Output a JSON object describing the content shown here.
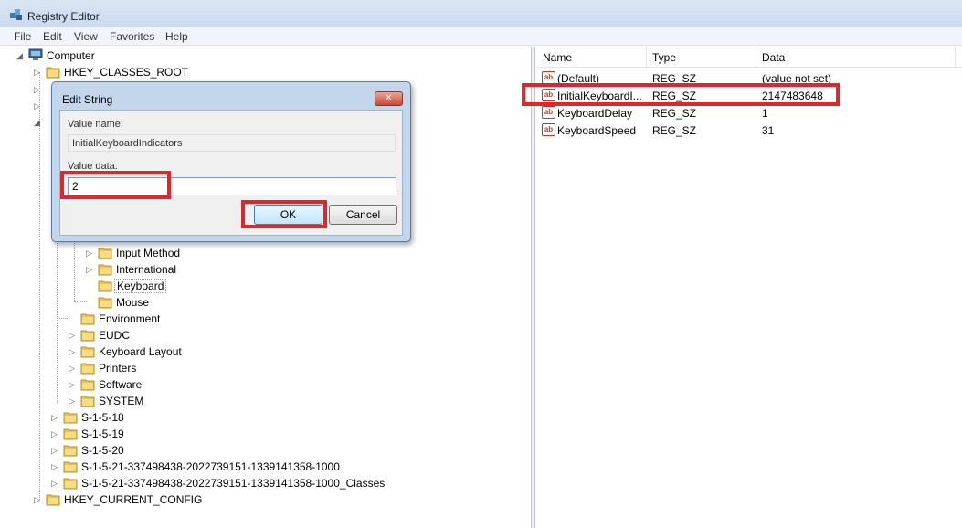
{
  "window": {
    "title": "Registry Editor"
  },
  "menu": [
    "File",
    "Edit",
    "View",
    "Favorites",
    "Help"
  ],
  "tree": {
    "root": "Computer",
    "items": [
      "HKEY_CLASSES_ROOT",
      "Input Method",
      "International",
      "Keyboard",
      "Mouse",
      "Environment",
      "EUDC",
      "Keyboard Layout",
      "Printers",
      "Software",
      "SYSTEM",
      "S-1-5-18",
      "S-1-5-19",
      "S-1-5-20",
      "S-1-5-21-337498438-2022739151-1339141358-1000",
      "S-1-5-21-337498438-2022739151-1339141358-1000_Classes",
      "HKEY_CURRENT_CONFIG"
    ],
    "selected": "Keyboard"
  },
  "list": {
    "columns": [
      "Name",
      "Type",
      "Data"
    ],
    "rows": [
      {
        "icon": "ab",
        "name": "(Default)",
        "type": "REG_SZ",
        "data": "(value not set)"
      },
      {
        "icon": "ab",
        "name": "InitialKeyboardI...",
        "type": "REG_SZ",
        "data": "2147483648"
      },
      {
        "icon": "ab",
        "name": "KeyboardDelay",
        "type": "REG_SZ",
        "data": "1"
      },
      {
        "icon": "ab",
        "name": "KeyboardSpeed",
        "type": "REG_SZ",
        "data": "31"
      }
    ]
  },
  "dialog": {
    "title": "Edit String",
    "close_glyph": "✕",
    "value_name_label": "Value name:",
    "value_name": "InitialKeyboardIndicators",
    "value_data_label": "Value data:",
    "value_data": "2",
    "ok_label": "OK",
    "cancel_label": "Cancel"
  },
  "highlight_color": "#e0262b"
}
